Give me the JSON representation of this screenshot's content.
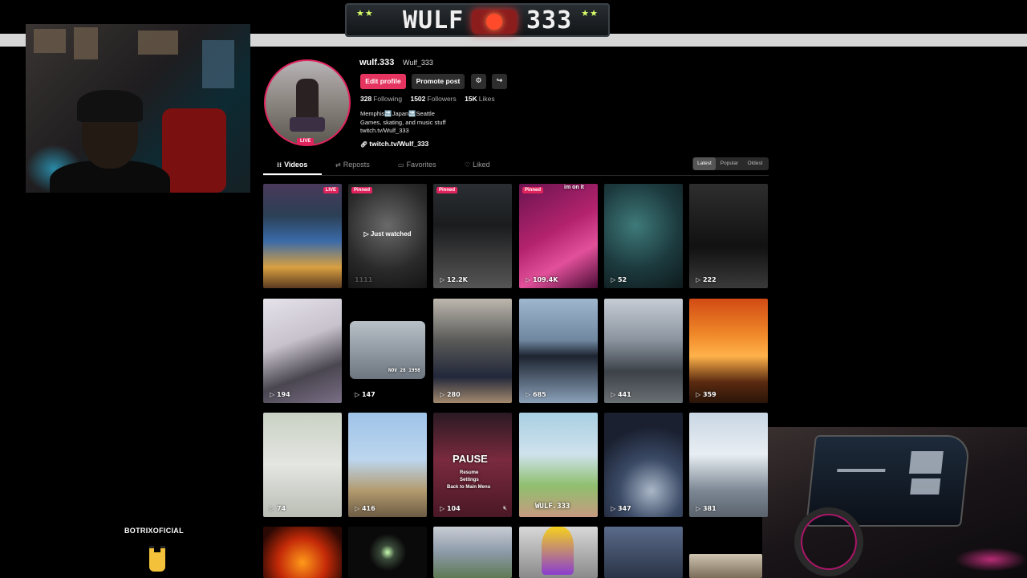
{
  "banner": {
    "left_stars": "★★",
    "title": "WULF",
    "number": "333",
    "right_stars": "★★"
  },
  "overlay": {
    "bot_name": "BOTRIXOFICIAL"
  },
  "profile": {
    "username": "wulf.333",
    "handle": "Wulf_333",
    "live_badge": "LIVE",
    "edit_label": "Edit profile",
    "promote_label": "Promote post",
    "stats": {
      "following_count": "328",
      "following_label": "Following",
      "followers_count": "1502",
      "followers_label": "Followers",
      "likes_count": "15K",
      "likes_label": "Likes"
    },
    "bio_line1": "Memphis🔜Japan🔜Seattle",
    "bio_line2": "Games, skating, and music stuff",
    "bio_line3": "twitch.tv/Wulf_333",
    "website": "twitch.tv/Wulf_333"
  },
  "tabs": [
    {
      "label": "Videos",
      "icon": "grid-icon",
      "glyph": "⁞⁞"
    },
    {
      "label": "Reposts",
      "icon": "repost-icon",
      "glyph": "⇄"
    },
    {
      "label": "Favorites",
      "icon": "bookmark-icon",
      "glyph": "▭"
    },
    {
      "label": "Liked",
      "icon": "heart-icon",
      "glyph": "♡"
    }
  ],
  "sort": [
    "Latest",
    "Popular",
    "Oldest"
  ],
  "videos": [
    {
      "views": "",
      "badge": "",
      "live": "LIVE",
      "overlay": ""
    },
    {
      "views": "1111",
      "badge": "Pinned",
      "live": "",
      "overlay": "▷ Just watched"
    },
    {
      "views": "12.2K",
      "badge": "Pinned",
      "live": "",
      "overlay": ""
    },
    {
      "views": "109.4K",
      "badge": "Pinned",
      "live": "",
      "overlay": "im on it"
    },
    {
      "views": "52",
      "badge": "",
      "live": "",
      "overlay": ""
    },
    {
      "views": "222",
      "badge": "",
      "live": "",
      "overlay": ""
    },
    {
      "views": "194",
      "badge": "",
      "live": "",
      "overlay": ""
    },
    {
      "views": "147",
      "badge": "",
      "live": "",
      "overlay": "NOV 28 1998"
    },
    {
      "views": "280",
      "badge": "",
      "live": "",
      "overlay": ""
    },
    {
      "views": "685",
      "badge": "",
      "live": "",
      "overlay": ""
    },
    {
      "views": "441",
      "badge": "",
      "live": "",
      "overlay": ""
    },
    {
      "views": "359",
      "badge": "",
      "live": "",
      "overlay": ""
    },
    {
      "views": "74",
      "badge": "",
      "live": "",
      "overlay": ""
    },
    {
      "views": "416",
      "badge": "",
      "live": "",
      "overlay": ""
    },
    {
      "views": "104",
      "badge": "",
      "live": "",
      "overlay": "PAUSE"
    },
    {
      "views": "",
      "badge": "",
      "live": "",
      "overlay": "WULF.333"
    },
    {
      "views": "347",
      "badge": "",
      "live": "",
      "overlay": ""
    },
    {
      "views": "381",
      "badge": "",
      "live": "",
      "overlay": ""
    },
    {
      "views": "",
      "badge": "",
      "live": "",
      "overlay": ""
    },
    {
      "views": "",
      "badge": "",
      "live": "",
      "overlay": ""
    },
    {
      "views": "",
      "badge": "",
      "live": "",
      "overlay": ""
    },
    {
      "views": "",
      "badge": "",
      "live": "",
      "overlay": ""
    },
    {
      "views": "",
      "badge": "",
      "live": "",
      "overlay": ""
    }
  ],
  "pause_menu": {
    "resume": "Resume",
    "settings": "Settings",
    "back": "Back to Main Menu"
  },
  "colors": {
    "accent": "#e5345f",
    "background": "#000000",
    "button_dark": "#2d2d2d"
  }
}
